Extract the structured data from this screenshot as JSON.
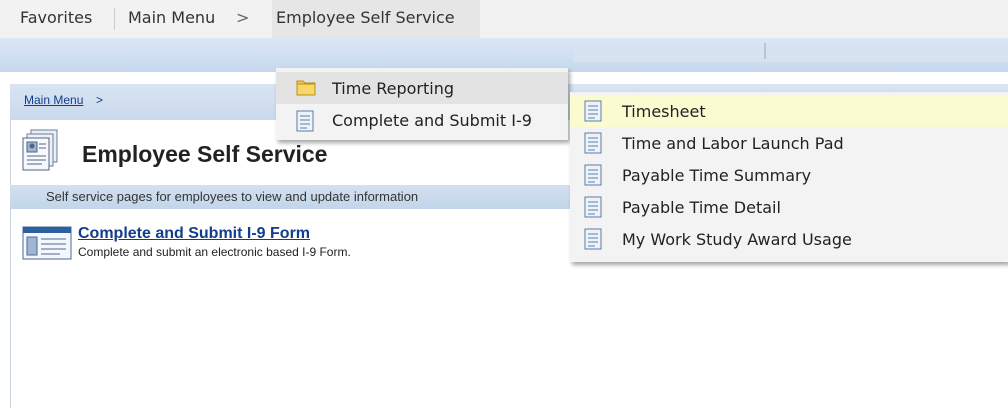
{
  "nav": {
    "favorites": "Favorites",
    "main_menu": "Main Menu",
    "separator": ">",
    "employee_self_service": "Employee Self Service"
  },
  "breadcrumb": {
    "main_menu": "Main Menu",
    "separator": ">"
  },
  "page": {
    "title": "Employee Self Service",
    "description": "Self service pages for employees to view and update information",
    "item": {
      "title": "Complete and Submit I-9 Form",
      "description": "Complete and submit an electronic based I-9 Form."
    }
  },
  "menu1": {
    "items": [
      {
        "label": "Time Reporting",
        "icon": "folder-icon"
      },
      {
        "label": "Complete and Submit I-9",
        "icon": "document-icon"
      }
    ]
  },
  "menu2": {
    "items": [
      {
        "label": "Timesheet",
        "icon": "document-icon"
      },
      {
        "label": "Time and Labor Launch Pad",
        "icon": "document-icon"
      },
      {
        "label": "Payable Time Summary",
        "icon": "document-icon"
      },
      {
        "label": "Payable Time Detail",
        "icon": "document-icon"
      },
      {
        "label": "My Work Study Award Usage",
        "icon": "document-icon"
      }
    ]
  },
  "colors": {
    "link": "#123d8c",
    "nav_arrow": "#2b63b3",
    "highlight": "#fbfbd2",
    "banner": "#c6d8ee"
  }
}
